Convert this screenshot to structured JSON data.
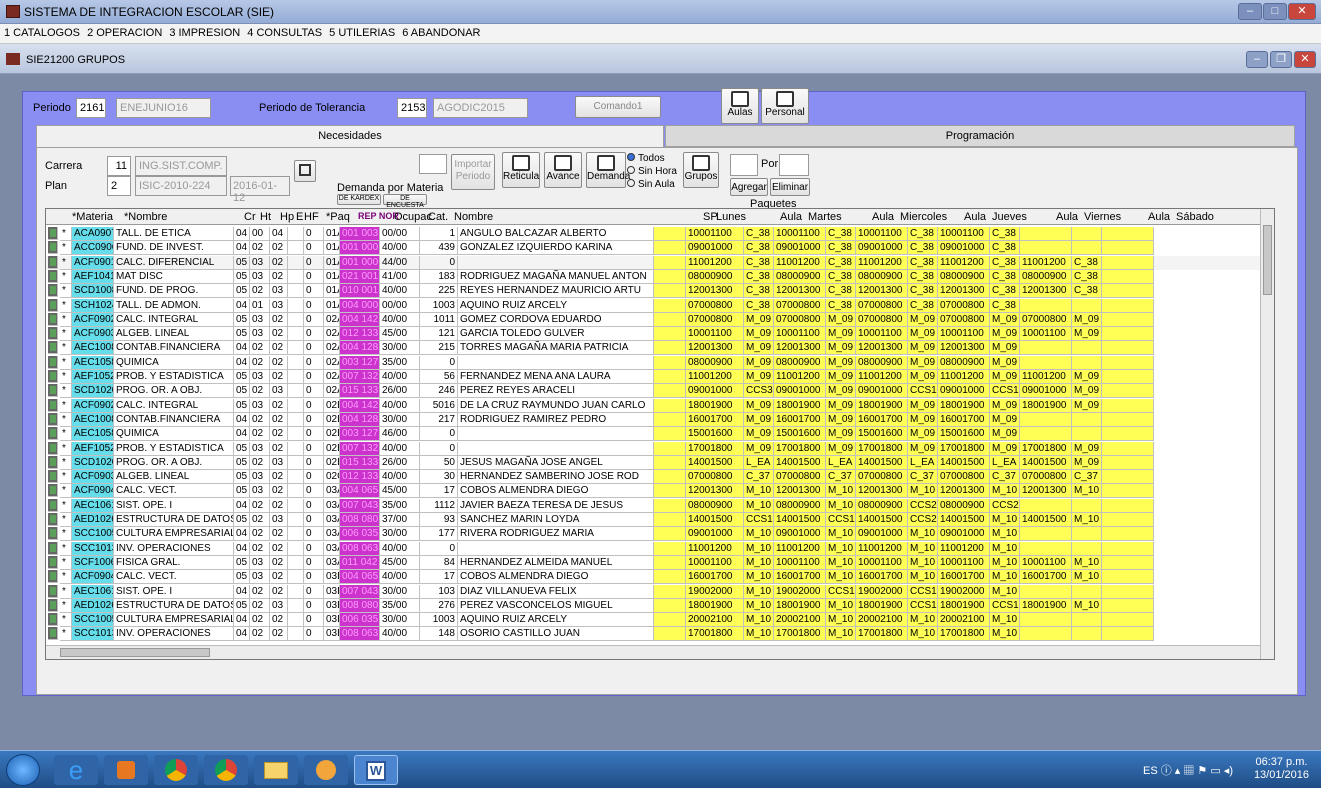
{
  "window": {
    "title": "SISTEMA DE INTEGRACION ESCOLAR (SIE)"
  },
  "menu": [
    "1 CATALOGOS",
    "2 OPERACION",
    "3 IMPRESION",
    "4 CONSULTAS",
    "5 UTILERIAS",
    "6 ABANDONAR"
  ],
  "child": {
    "title": "SIE21200 GRUPOS"
  },
  "form": {
    "periodo_label": "Periodo",
    "periodo": "2161",
    "periodo_desc": "ENEJUNIO16",
    "tol_label": "Periodo de Tolerancia",
    "tol": "2153",
    "tol_desc": "AGODIC2015",
    "comando": "Comando1",
    "aulas": "Aulas",
    "personal": "Personal"
  },
  "tabs": [
    "Necesidades",
    "Programación"
  ],
  "filters": {
    "carrera_label": "Carrera",
    "carrera": "11",
    "carrera_desc": "ING.SIST.COMP.",
    "plan_label": "Plan",
    "plan": "2",
    "plan_desc": "ISIC-2010-224",
    "plan_date": "2016-01-12",
    "demanda": "Demanda por Materia",
    "kardex": "DE KARDEX",
    "encuesta": "DE ENCUESTA",
    "importar": "Importar",
    "periodo": "Periodo",
    "reticula": "Reticula",
    "avance": "Avance",
    "demanda_btn": "Demanda",
    "grupos": "Grupos",
    "radio1": "Todos",
    "radio2": "Sin Hora",
    "radio3": "Sin Aula",
    "por": "Por",
    "agregar": "Agregar",
    "eliminar": "Eliminar",
    "paquetes": "Paquetes"
  },
  "headers": [
    "*Materia",
    "*Nombre",
    "Cr",
    "Ht",
    "Hp",
    "E",
    "HF",
    "*Paq",
    "REP NOR",
    "Ocupac.",
    "Cat.",
    "Nombre",
    "SP",
    "Lunes",
    "Aula",
    "Martes",
    "Aula",
    "Miercoles",
    "Aula",
    "Jueves",
    "Aula",
    "Viernes",
    "Aula",
    "Sábado"
  ],
  "rows": [
    [
      "ACA0907",
      "TALL. DE ETICA",
      "04",
      "00",
      "04",
      "0",
      "01A",
      "001 003",
      "00/00",
      "1",
      "ANGULO BALCAZAR ALBERTO",
      "10001100",
      "C_38",
      "10001100",
      "C_38",
      "10001100",
      "C_38",
      "10001100",
      "C_38",
      "",
      ""
    ],
    [
      "ACC0906",
      "FUND. DE INVEST.",
      "04",
      "02",
      "02",
      "0",
      "01A",
      "001 000",
      "40/00",
      "439",
      "GONZALEZ IZQUIERDO KARINA",
      "09001000",
      "C_38",
      "09001000",
      "C_38",
      "09001000",
      "C_38",
      "09001000",
      "C_38",
      "",
      ""
    ],
    [
      "ACF0901",
      "CALC. DIFERENCIAL",
      "05",
      "03",
      "02",
      "0",
      "01A",
      "001 000",
      "44/00",
      "0",
      "",
      "11001200",
      "C_38",
      "11001200",
      "C_38",
      "11001200",
      "C_38",
      "11001200",
      "C_38",
      "11001200",
      "C_38"
    ],
    [
      "AEF1041",
      "MAT DISC",
      "05",
      "03",
      "02",
      "0",
      "01A",
      "021 001",
      "41/00",
      "183",
      "RODRIGUEZ MAGAÑA MANUEL ANTON",
      "08000900",
      "C_38",
      "08000900",
      "C_38",
      "08000900",
      "C_38",
      "08000900",
      "C_38",
      "08000900",
      "C_38"
    ],
    [
      "SCD1008",
      "FUND. DE PROG.",
      "05",
      "02",
      "03",
      "0",
      "01A",
      "010 001",
      "40/00",
      "225",
      "REYES HERNANDEZ MAURICIO ARTU",
      "12001300",
      "C_38",
      "12001300",
      "C_38",
      "12001300",
      "C_38",
      "12001300",
      "C_38",
      "12001300",
      "C_38"
    ],
    [
      "SCH1024",
      "TALL. DE ADMON.",
      "04",
      "01",
      "03",
      "0",
      "01A",
      "004 000",
      "00/00",
      "1003",
      "AQUINO RUIZ ARCELY",
      "07000800",
      "C_38",
      "07000800",
      "C_38",
      "07000800",
      "C_38",
      "07000800",
      "C_38",
      "",
      ""
    ],
    [
      "ACF0902",
      "CALC. INTEGRAL",
      "05",
      "03",
      "02",
      "0",
      "02A",
      "004 142",
      "40/00",
      "1011",
      "GOMEZ CORDOVA EDUARDO",
      "07000800",
      "M_09",
      "07000800",
      "M_09",
      "07000800",
      "M_09",
      "07000800",
      "M_09",
      "07000800",
      "M_09"
    ],
    [
      "ACF0903",
      "ALGEB. LINEAL",
      "05",
      "03",
      "02",
      "0",
      "02A",
      "012 133",
      "45/00",
      "121",
      "GARCIA TOLEDO GULVER",
      "10001100",
      "M_09",
      "10001100",
      "M_09",
      "10001100",
      "M_09",
      "10001100",
      "M_09",
      "10001100",
      "M_09"
    ],
    [
      "AEC1008",
      "CONTAB.FINANCIERA",
      "04",
      "02",
      "02",
      "0",
      "02A",
      "004 128",
      "30/00",
      "215",
      "TORRES MAGAÑA MARIA PATRICIA",
      "12001300",
      "M_09",
      "12001300",
      "M_09",
      "12001300",
      "M_09",
      "12001300",
      "M_09",
      "",
      ""
    ],
    [
      "AEC1058",
      "QUIMICA",
      "04",
      "02",
      "02",
      "0",
      "02A",
      "003 127",
      "35/00",
      "0",
      "",
      "08000900",
      "M_09",
      "08000900",
      "M_09",
      "08000900",
      "M_09",
      "08000900",
      "M_09",
      "",
      ""
    ],
    [
      "AEF1052",
      "PROB. Y ESTADISTICA",
      "05",
      "03",
      "02",
      "0",
      "02A",
      "007 132",
      "40/00",
      "56",
      "FERNANDEZ MENA ANA LAURA",
      "11001200",
      "M_09",
      "11001200",
      "M_09",
      "11001200",
      "M_09",
      "11001200",
      "M_09",
      "11001200",
      "M_09"
    ],
    [
      "SCD1020",
      "PROG. OR. A OBJ.",
      "05",
      "02",
      "03",
      "0",
      "02A",
      "015 133",
      "26/00",
      "246",
      "PEREZ REYES ARACELI",
      "09001000",
      "CCS3",
      "09001000",
      "M_09",
      "09001000",
      "CCS1",
      "09001000",
      "CCS1",
      "09001000",
      "M_09"
    ],
    [
      "ACF0902",
      "CALC. INTEGRAL",
      "05",
      "03",
      "02",
      "0",
      "02B",
      "004 142",
      "40/00",
      "5016",
      "DE LA CRUZ RAYMUNDO JUAN CARLO",
      "18001900",
      "M_09",
      "18001900",
      "M_09",
      "18001900",
      "M_09",
      "18001900",
      "M_09",
      "18001900",
      "M_09"
    ],
    [
      "AEC1008",
      "CONTAB.FINANCIERA",
      "04",
      "02",
      "02",
      "0",
      "02B",
      "004 128",
      "30/00",
      "217",
      "RODRIGUEZ RAMIREZ PEDRO",
      "16001700",
      "M_09",
      "16001700",
      "M_09",
      "16001700",
      "M_09",
      "16001700",
      "M_09",
      "",
      ""
    ],
    [
      "AEC1058",
      "QUIMICA",
      "04",
      "02",
      "02",
      "0",
      "02B",
      "003 127",
      "46/00",
      "0",
      "",
      "15001600",
      "M_09",
      "15001600",
      "M_09",
      "15001600",
      "M_09",
      "15001600",
      "M_09",
      "",
      ""
    ],
    [
      "AEF1052",
      "PROB. Y ESTADISTICA",
      "05",
      "03",
      "02",
      "0",
      "02B",
      "007 132",
      "40/00",
      "0",
      "",
      "17001800",
      "M_09",
      "17001800",
      "M_09",
      "17001800",
      "M_09",
      "17001800",
      "M_09",
      "17001800",
      "M_09"
    ],
    [
      "SCD1020",
      "PROG. OR. A OBJ.",
      "05",
      "02",
      "03",
      "0",
      "02B",
      "015 133",
      "26/00",
      "50",
      "JESUS MAGAÑA JOSE ANGEL",
      "14001500",
      "L_EA",
      "14001500",
      "L_EA",
      "14001500",
      "L_EA",
      "14001500",
      "L_EA",
      "14001500",
      "M_09"
    ],
    [
      "ACF0903",
      "ALGEB. LINEAL",
      "05",
      "03",
      "02",
      "0",
      "02C",
      "012 133",
      "40/00",
      "30",
      "HERNANDEZ SAMBERINO JOSE ROD",
      "07000800",
      "C_37",
      "07000800",
      "C_37",
      "07000800",
      "C_37",
      "07000800",
      "C_37",
      "07000800",
      "C_37"
    ],
    [
      "ACF0904",
      "CALC. VECT.",
      "05",
      "03",
      "02",
      "0",
      "03A",
      "004 065",
      "45/00",
      "17",
      "COBOS ALMENDRA DIEGO",
      "12001300",
      "M_10",
      "12001300",
      "M_10",
      "12001300",
      "M_10",
      "12001300",
      "M_10",
      "12001300",
      "M_10"
    ],
    [
      "AEC1061",
      "SIST. OPE. I",
      "04",
      "02",
      "02",
      "0",
      "03A",
      "007 043",
      "35/00",
      "1112",
      "JAVIER BAEZA TERESA DE JESUS",
      "08000900",
      "M_10",
      "08000900",
      "M_10",
      "08000900",
      "CCS2",
      "08000900",
      "CCS2",
      "",
      ""
    ],
    [
      "AED1026",
      "ESTRUCTURA DE DATOS",
      "05",
      "02",
      "03",
      "0",
      "03A",
      "008 080",
      "37/00",
      "93",
      "SANCHEZ MARIN LOYDA",
      "14001500",
      "CCS1",
      "14001500",
      "CCS1",
      "14001500",
      "CCS2",
      "14001500",
      "M_10",
      "14001500",
      "M_10"
    ],
    [
      "SCC1005",
      "CULTURA EMPRESARIAL",
      "04",
      "02",
      "02",
      "0",
      "03A",
      "006 035",
      "30/00",
      "177",
      "RIVERA RODRIGUEZ MARIA",
      "09001000",
      "M_10",
      "09001000",
      "M_10",
      "09001000",
      "M_10",
      "09001000",
      "M_10",
      "",
      ""
    ],
    [
      "SCC1013",
      "INV. OPERACIONES",
      "04",
      "02",
      "02",
      "0",
      "03A",
      "008 063",
      "40/00",
      "0",
      "",
      "11001200",
      "M_10",
      "11001200",
      "M_10",
      "11001200",
      "M_10",
      "11001200",
      "M_10",
      "",
      ""
    ],
    [
      "SCF1006",
      "FISICA GRAL.",
      "05",
      "03",
      "02",
      "0",
      "03A",
      "011 042",
      "45/00",
      "84",
      "HERNANDEZ ALMEIDA MANUEL",
      "10001100",
      "M_10",
      "10001100",
      "M_10",
      "10001100",
      "M_10",
      "10001100",
      "M_10",
      "10001100",
      "M_10"
    ],
    [
      "ACF0904",
      "CALC. VECT.",
      "05",
      "03",
      "02",
      "0",
      "03B",
      "004 065",
      "40/00",
      "17",
      "COBOS ALMENDRA DIEGO",
      "16001700",
      "M_10",
      "16001700",
      "M_10",
      "16001700",
      "M_10",
      "16001700",
      "M_10",
      "16001700",
      "M_10"
    ],
    [
      "AEC1061",
      "SIST. OPE. I",
      "04",
      "02",
      "02",
      "0",
      "03B",
      "007 043",
      "30/00",
      "103",
      "DIAZ VILLANUEVA FELIX",
      "19002000",
      "M_10",
      "19002000",
      "CCS1",
      "19002000",
      "CCS1",
      "19002000",
      "M_10",
      "",
      ""
    ],
    [
      "AED1026",
      "ESTRUCTURA DE DATOS",
      "05",
      "02",
      "03",
      "0",
      "03B",
      "008 080",
      "35/00",
      "276",
      "PEREZ VASCONCELOS MIGUEL",
      "18001900",
      "M_10",
      "18001900",
      "M_10",
      "18001900",
      "CCS1",
      "18001900",
      "CCS1",
      "18001900",
      "M_10"
    ],
    [
      "SCC1005",
      "CULTURA EMPRESARIAL",
      "04",
      "02",
      "02",
      "0",
      "03B",
      "006 035",
      "30/00",
      "1003",
      "AQUINO RUIZ ARCELY",
      "20002100",
      "M_10",
      "20002100",
      "M_10",
      "20002100",
      "M_10",
      "20002100",
      "M_10",
      "",
      ""
    ],
    [
      "SCC1013",
      "INV. OPERACIONES",
      "04",
      "02",
      "02",
      "0",
      "03B",
      "008 063",
      "40/00",
      "148",
      "OSORIO CASTILLO JUAN",
      "17001800",
      "M_10",
      "17001800",
      "M_10",
      "17001800",
      "M_10",
      "17001800",
      "M_10",
      "",
      ""
    ]
  ],
  "taskbar": {
    "lang": "ES",
    "time": "06:37 p.m.",
    "date": "13/01/2016"
  }
}
